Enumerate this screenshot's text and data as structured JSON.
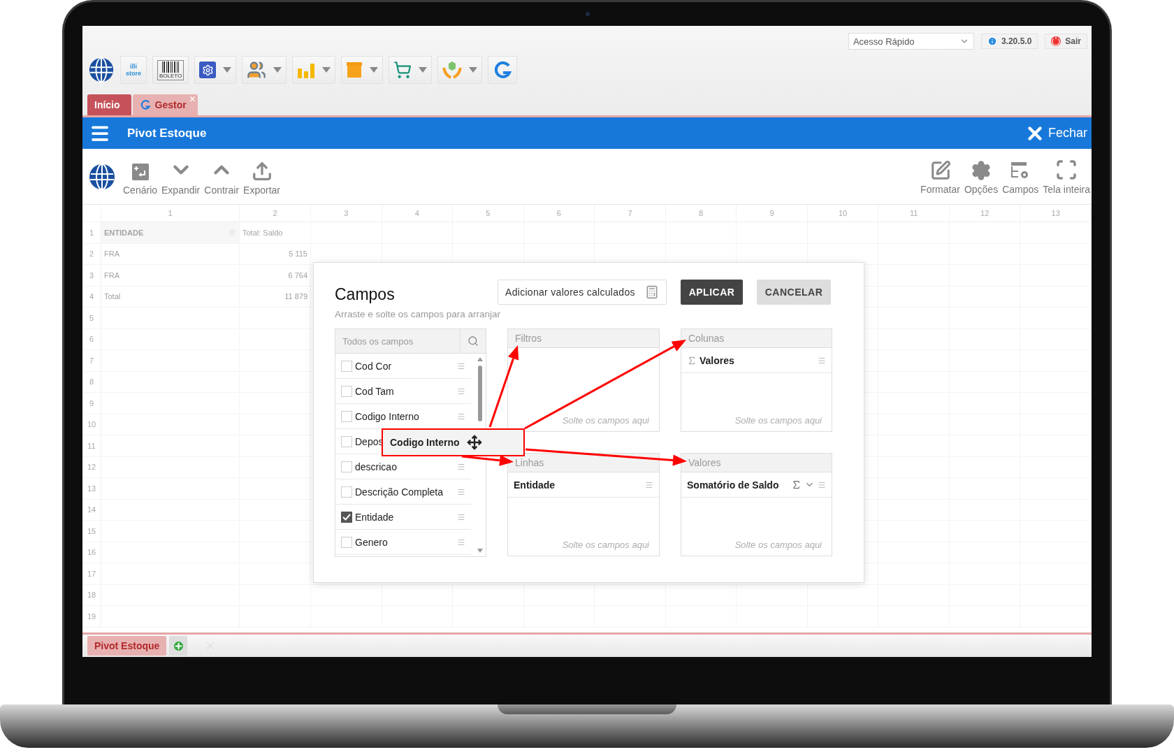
{
  "top_bar": {
    "quick_access": {
      "placeholder": "Acesso Rápido"
    },
    "version": "3.20.5.0",
    "logout": "Sair"
  },
  "app_toolbar": [
    {
      "kind": "store",
      "lines": [
        "illi",
        "store"
      ],
      "has_menu": false
    },
    {
      "kind": "boleto",
      "lines": [
        "BOLETO"
      ],
      "has_menu": false
    },
    {
      "kind": "settings",
      "has_menu": true
    },
    {
      "kind": "people",
      "has_menu": true
    },
    {
      "kind": "chart",
      "has_menu": true
    },
    {
      "kind": "box",
      "has_menu": true
    },
    {
      "kind": "cart",
      "has_menu": true
    },
    {
      "kind": "hands",
      "has_menu": true
    },
    {
      "kind": "refresh",
      "has_menu": false
    }
  ],
  "tabs": [
    {
      "label": "Início",
      "selected": true,
      "closable": false
    },
    {
      "label": "Gestor",
      "selected": false,
      "closable": true
    }
  ],
  "header": {
    "title": "Pivot Estoque",
    "close": "Fechar"
  },
  "toolbar": {
    "left": [
      {
        "kind": "scenario",
        "label": "Cenário"
      },
      {
        "kind": "expand",
        "label": "Expandir"
      },
      {
        "kind": "collapse",
        "label": "Contrair"
      },
      {
        "kind": "export",
        "label": "Exportar"
      }
    ],
    "right": [
      {
        "kind": "format",
        "label": "Formatar"
      },
      {
        "kind": "options",
        "label": "Opções"
      },
      {
        "kind": "fields",
        "label": "Campos"
      },
      {
        "kind": "fullscreen",
        "label": "Tela inteira"
      }
    ]
  },
  "grid": {
    "columns": [
      "1",
      "2",
      "3",
      "4",
      "5",
      "6",
      "7",
      "8",
      "9",
      "10",
      "11",
      "12",
      "13"
    ],
    "rows": [
      {
        "number": "1",
        "kind": "header",
        "cells": [
          "ENTIDADE",
          "Total: Saldo"
        ]
      },
      {
        "number": "2",
        "kind": "data",
        "cells": [
          "FRA",
          "5 115"
        ]
      },
      {
        "number": "3",
        "kind": "data",
        "cells": [
          "FRA",
          "6 764"
        ]
      },
      {
        "number": "4",
        "kind": "total",
        "cells": [
          "Total",
          "11 879"
        ]
      },
      {
        "number": "5"
      },
      {
        "number": "6"
      },
      {
        "number": "7"
      },
      {
        "number": "8"
      },
      {
        "number": "9"
      },
      {
        "number": "10"
      },
      {
        "number": "11"
      },
      {
        "number": "12"
      },
      {
        "number": "13"
      },
      {
        "number": "14"
      },
      {
        "number": "15"
      },
      {
        "number": "16"
      },
      {
        "number": "17"
      },
      {
        "number": "18"
      },
      {
        "number": "19"
      }
    ]
  },
  "dialog": {
    "title": "Campos",
    "add_calculated": "Adicionar valores calculados",
    "apply": "APLICAR",
    "cancel": "CANCELAR",
    "hint": "Arraste e solte os campos para arranjar",
    "field_list": {
      "placeholder": "Todos os campos",
      "fields": [
        {
          "label": "Cod Cor",
          "checked": false
        },
        {
          "label": "Cod Tam",
          "checked": false
        },
        {
          "label": "Codigo Interno",
          "checked": false
        },
        {
          "label": "Depos",
          "checked": false
        },
        {
          "label": "descricao",
          "checked": false
        },
        {
          "label": "Descrição Completa",
          "checked": false
        },
        {
          "label": "Entidade",
          "checked": true
        },
        {
          "label": "Genero",
          "checked": false
        }
      ]
    },
    "drop_zones": [
      {
        "title": "Filtros",
        "empty_hint": "Solte os campos aqui"
      },
      {
        "title": "Colunas",
        "items": [
          {
            "label": "Valores",
            "kind": "values"
          }
        ],
        "empty_hint": "Solte os campos aqui"
      },
      {
        "title": "Linhas",
        "items": [
          {
            "label": "Entidade",
            "kind": "field"
          }
        ],
        "empty_hint": "Solte os campos aqui"
      },
      {
        "title": "Valores",
        "items": [
          {
            "label": "Somatório de Saldo",
            "kind": "aggregate"
          }
        ],
        "empty_hint": "Solte os campos aqui"
      }
    ],
    "drag_item": {
      "label": "Codigo Interno"
    }
  },
  "bottom_tabs": [
    {
      "label": "Pivot Estoque",
      "selected": true
    }
  ]
}
